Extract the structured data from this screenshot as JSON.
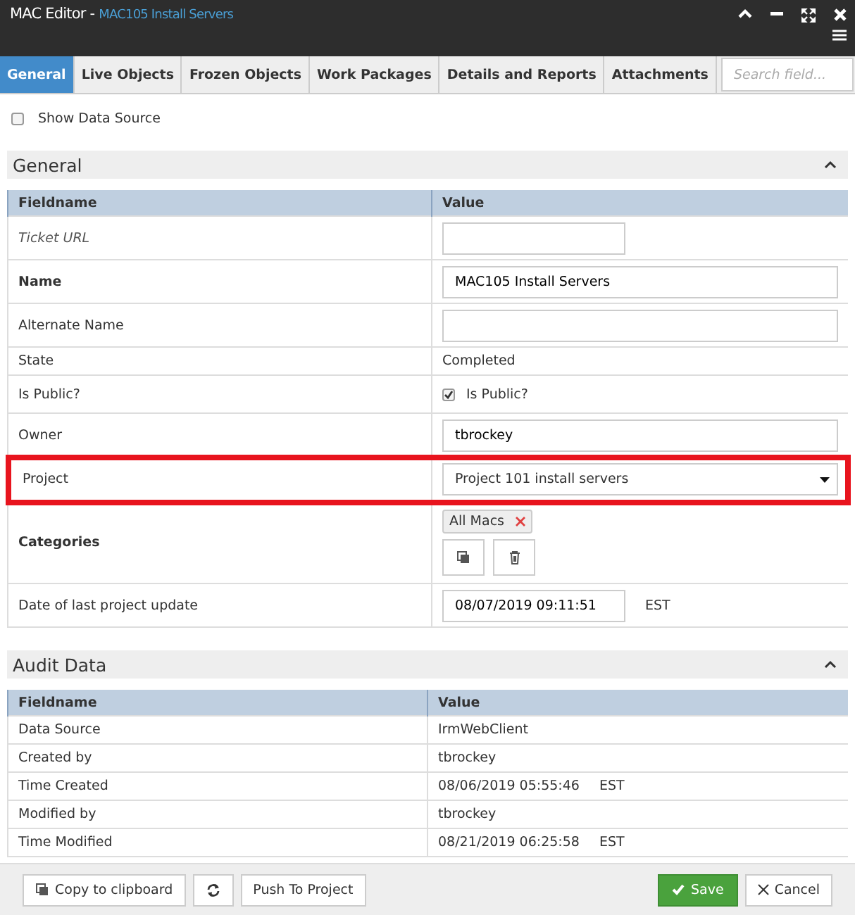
{
  "window": {
    "title": "MAC Editor -",
    "subtitle": "MAC105 Install Servers"
  },
  "tabs": [
    {
      "label": "General",
      "selected": true
    },
    {
      "label": "Live Objects",
      "selected": false
    },
    {
      "label": "Frozen Objects",
      "selected": false
    },
    {
      "label": "Work Packages",
      "selected": false
    },
    {
      "label": "Details and Reports",
      "selected": false
    },
    {
      "label": "Attachments",
      "selected": false
    }
  ],
  "search": {
    "placeholder": "Search field..."
  },
  "show_data_source": {
    "label": "Show Data Source",
    "checked": false
  },
  "general": {
    "title": "General",
    "expanded": true,
    "columns": [
      "Fieldname",
      "Value"
    ],
    "rows": [
      {
        "label": "Ticket URL",
        "italic": true,
        "bold": false,
        "kind": "input",
        "wide": false,
        "highlighted": false
      },
      {
        "label": "Name",
        "italic": false,
        "bold": true,
        "kind": "input",
        "wide": true,
        "value": "MAC105 Install Servers",
        "highlighted": false
      },
      {
        "label": "Alternate Name",
        "italic": false,
        "bold": false,
        "kind": "input",
        "wide": true,
        "highlighted": false
      },
      {
        "label": "State",
        "italic": false,
        "bold": false,
        "kind": "text",
        "value": "Completed",
        "highlighted": false
      },
      {
        "label": "Is Public?",
        "italic": false,
        "bold": false,
        "kind": "checkbox",
        "value": "Is Public?",
        "checked": true,
        "highlighted": false
      },
      {
        "label": "Owner",
        "italic": false,
        "bold": false,
        "kind": "input",
        "wide": true,
        "value": "tbrockey",
        "highlighted": false
      },
      {
        "label": "Project",
        "italic": false,
        "bold": false,
        "kind": "select",
        "value": "Project 101 install servers",
        "highlighted": true
      },
      {
        "label": "Categories",
        "italic": false,
        "bold": true,
        "kind": "tags",
        "tags": [
          "All Macs"
        ],
        "highlighted": false
      },
      {
        "label": "Date of last project update",
        "italic": false,
        "bold": false,
        "kind": "input",
        "wide": false,
        "value": "08/07/2019 09:11:51",
        "suffix": "EST",
        "highlighted": false
      }
    ]
  },
  "audit": {
    "title": "Audit Data",
    "expanded": true,
    "columns": [
      "Fieldname",
      "Value"
    ],
    "rows": [
      {
        "label": "Data Source",
        "value": "IrmWebClient"
      },
      {
        "label": "Created by",
        "value": "tbrockey"
      },
      {
        "label": "Time Created",
        "value": "08/06/2019 05:55:46",
        "suffix": "EST"
      },
      {
        "label": "Modified by",
        "value": "tbrockey"
      },
      {
        "label": "Time Modified",
        "value": "08/21/2019 06:25:58",
        "suffix": "EST"
      }
    ]
  },
  "footer": {
    "left": [
      {
        "kind": "copy",
        "label": "Copy to clipboard"
      },
      {
        "kind": "refresh"
      },
      {
        "kind": "plain",
        "label": "Push To Project"
      }
    ],
    "right": [
      {
        "kind": "save",
        "label": "Save"
      },
      {
        "kind": "cancel",
        "label": "Cancel"
      }
    ]
  }
}
